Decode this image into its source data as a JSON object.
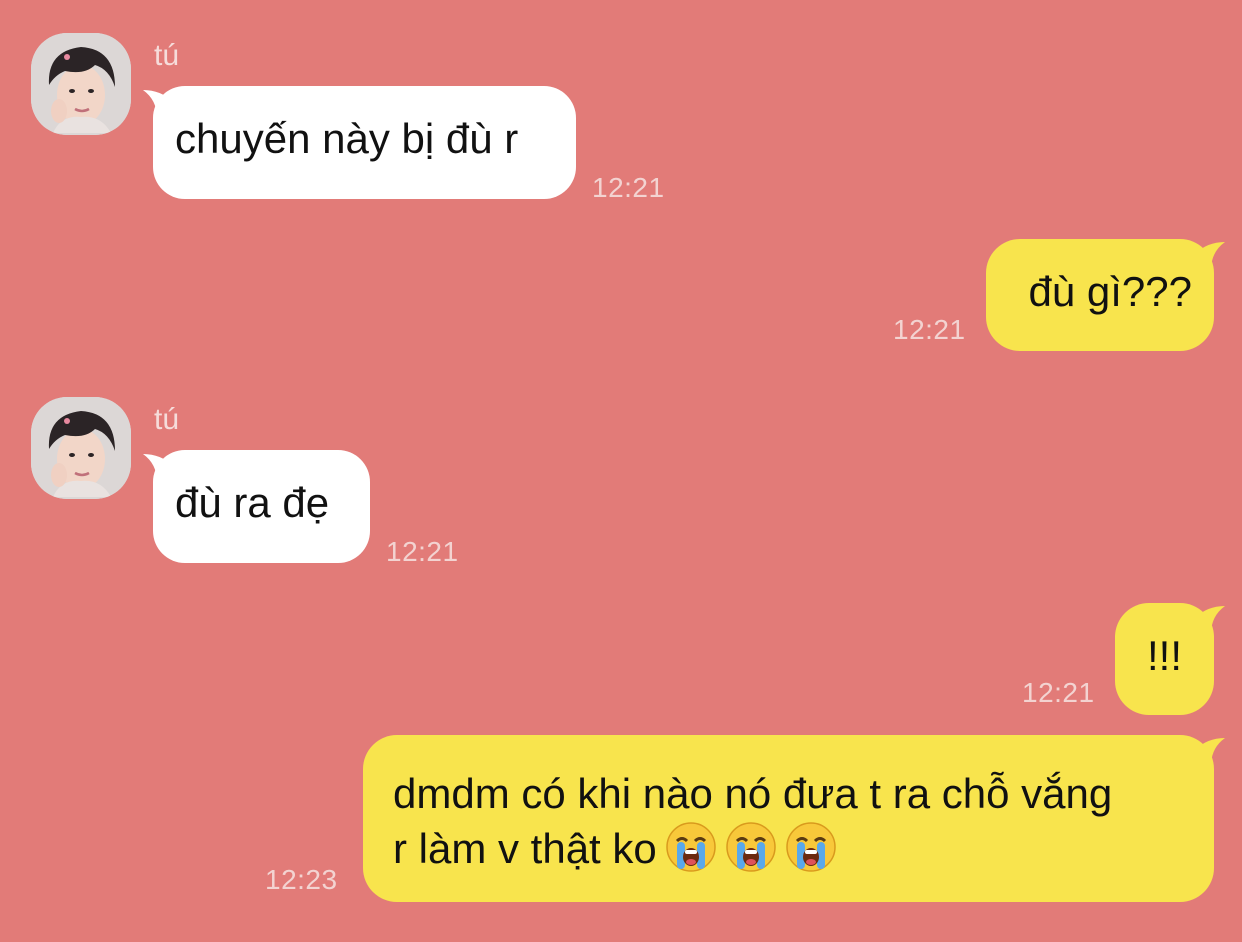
{
  "conversation": {
    "messages": [
      {
        "direction": "incoming",
        "sender": "tú",
        "text": "chuyến này bị đù r",
        "time": "12:21"
      },
      {
        "direction": "outgoing",
        "text": "đù gì???",
        "time": "12:21"
      },
      {
        "direction": "incoming",
        "sender": "tú",
        "text": "đù ra đẹ",
        "time": "12:21"
      },
      {
        "direction": "outgoing",
        "text": "!!!",
        "time": "12:21"
      },
      {
        "direction": "outgoing",
        "line1": "dmdm có khi nào nó đưa t ra chỗ vắng",
        "line2": "r làm v thật ko",
        "emojis": [
          "loudly-crying-face",
          "loudly-crying-face",
          "loudly-crying-face"
        ],
        "time": "12:23"
      }
    ]
  },
  "colors": {
    "background": "#e27b78",
    "incoming_bubble": "#ffffff",
    "outgoing_bubble": "#f8e44d",
    "timestamp": "#f3d3d1"
  }
}
